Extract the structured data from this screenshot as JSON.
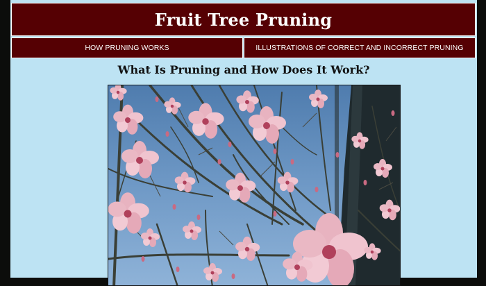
{
  "header": {
    "title": "Fruit Tree Pruning"
  },
  "nav": {
    "items": [
      {
        "label": "HOW PRUNING WORKS"
      },
      {
        "label": "ILLUSTRATIONS OF CORRECT AND INCORRECT PRUNING"
      }
    ]
  },
  "main": {
    "section_title": "What Is Pruning and How Does It Work?",
    "photo": {
      "subject": "peach-blossom-branches-photo"
    }
  },
  "colors": {
    "page_background": "#bde3f3",
    "header_background": "#550003",
    "outer_background": "#0c0d0b",
    "text_light": "#ffffff",
    "text_dark": "#111111"
  }
}
